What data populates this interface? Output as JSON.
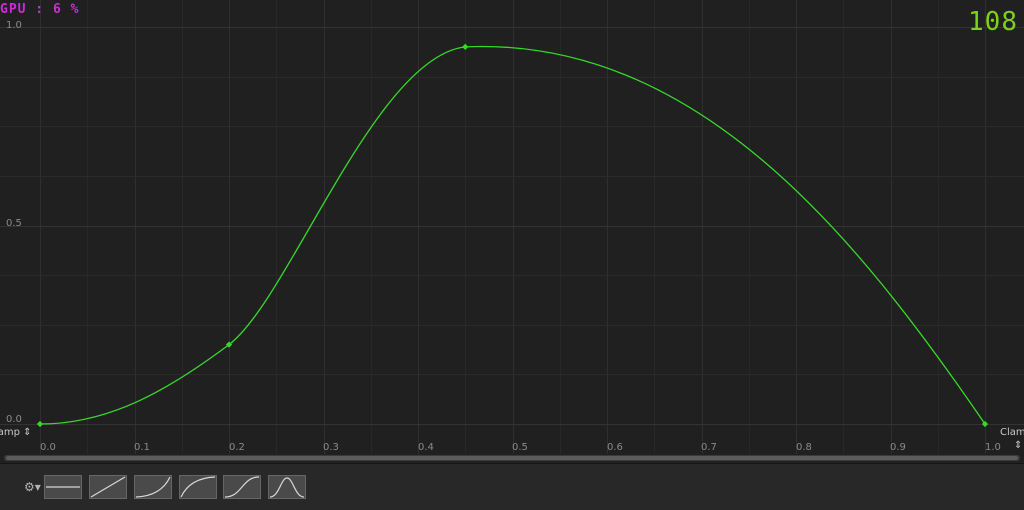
{
  "overlay": {
    "gpu_text": "GPU  : 6 %",
    "fps": "108"
  },
  "curve_editor": {
    "y_ticks": [
      "1.0",
      "0.5",
      "0.0"
    ],
    "x_ticks": [
      "0.0",
      "0.1",
      "0.2",
      "0.3",
      "0.4",
      "0.5",
      "0.6",
      "0.7",
      "0.8",
      "0.9",
      "1.0"
    ],
    "pre_wrap_mode": "Clamp",
    "post_wrap_mode": "Clamp",
    "curve_color": "#37d82a",
    "keyframes": [
      {
        "time": 0.0,
        "value": 0.0
      },
      {
        "time": 0.2,
        "value": 0.2
      },
      {
        "time": 0.45,
        "value": 0.95
      },
      {
        "time": 1.0,
        "value": 0.0
      }
    ]
  },
  "presets": {
    "settings_icon": "gear-icon",
    "items": [
      {
        "name": "constant"
      },
      {
        "name": "linear"
      },
      {
        "name": "ease-in"
      },
      {
        "name": "ease-out"
      },
      {
        "name": "ease-in-out"
      },
      {
        "name": "bell"
      }
    ]
  }
}
